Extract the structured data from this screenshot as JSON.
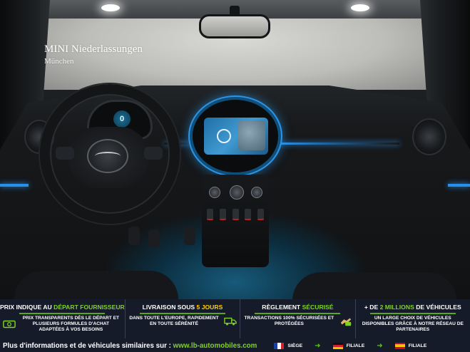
{
  "photo": {
    "watermark_title": "MINI Niederlassungen",
    "watermark_subtitle": "München",
    "cluster_readout": "0"
  },
  "banner": {
    "columns": [
      {
        "head_plain": "PRIX INDIQUE AU ",
        "head_highlight": "DÉPART FOURNISSEUR",
        "head_tail": "",
        "icon": "cash-icon",
        "text": "PRIX TRANSPARENTS DÈS LE DÉPART ET PLUSIEURS FORMULES D'ACHAT ADAPTÉES À VOS BESOINS"
      },
      {
        "head_plain": "LIVRAISON SOUS ",
        "head_highlight": "5 JOURS",
        "head_tail": "",
        "icon": "truck-icon",
        "text": "DANS TOUTE L'EUROPE, RAPIDEMENT EN TOUTE SÉRÉNITÉ"
      },
      {
        "head_plain": "RÈGLEMENT ",
        "head_highlight": "SÉCURISÉ",
        "head_tail": "",
        "icon": "secure-payment-icon",
        "text": "TRANSACTIONS 100% SÉCURISÉES ET PROTÉGÉES"
      },
      {
        "head_plain": "+ DE ",
        "head_highlight": "2 MILLIONS",
        "head_tail": " DE VÉHICULES",
        "icon": "",
        "text": "UN LARGE CHOIX DE VÉHICULES DISPONIBLES GRÂCE À NOTRE RÉSEAU DE PARTENAIRES"
      }
    ],
    "footer": {
      "text": "Plus d'informations et de véhicules similaires sur : ",
      "url": "www.lb-automobiles.com",
      "legend": [
        {
          "flag": "fr",
          "label": "SIÈGE"
        },
        {
          "flag": "de",
          "label": "FILIALE"
        },
        {
          "flag": "es",
          "label": "FILIALE"
        }
      ],
      "arrow_glyph": "➜"
    },
    "colors": {
      "background": "#161b2a",
      "accent_green": "#7fd321",
      "accent_yellow": "#ffd000",
      "ambient_blue": "#2a8fe6"
    }
  }
}
